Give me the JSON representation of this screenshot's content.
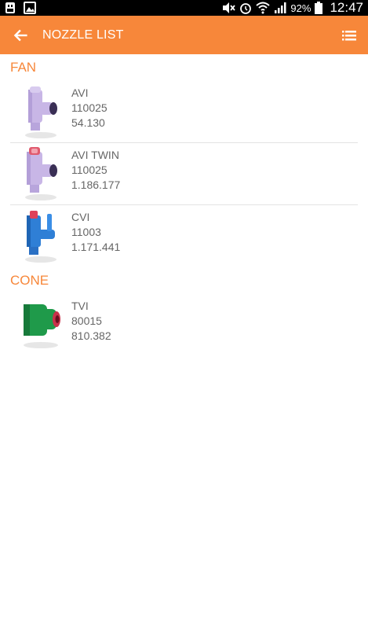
{
  "status_bar": {
    "battery_percent": "92%",
    "time": "12:47",
    "icons": [
      "usb-icon",
      "image-icon",
      "mute-icon",
      "alarm-icon",
      "wifi-icon",
      "signal-icon",
      "battery-icon"
    ]
  },
  "app_bar": {
    "title": "NOZZLE LIST",
    "back_icon": "arrow-back-icon",
    "menu_icon": "list-view-icon"
  },
  "colors": {
    "accent": "#f7873a",
    "secondary_text": "#666666"
  },
  "sections": [
    {
      "title": "FAN",
      "items": [
        {
          "name": "AVI",
          "size": "110025",
          "code": "54.130",
          "icon": "lilac-nozzle-icon",
          "color": "#c8b6e6"
        },
        {
          "name": "AVI TWIN",
          "size": "110025",
          "code": "1.186.177",
          "icon": "lilac-twin-nozzle-icon",
          "color": "#c8b6e6"
        },
        {
          "name": "CVI",
          "size": "11003",
          "code": "1.171.441",
          "icon": "blue-nozzle-icon",
          "color": "#2f7fd6"
        }
      ]
    },
    {
      "title": "CONE",
      "items": [
        {
          "name": "TVI",
          "size": "80015",
          "code": "810.382",
          "icon": "green-nozzle-icon",
          "color": "#1f9a4a"
        }
      ]
    }
  ]
}
